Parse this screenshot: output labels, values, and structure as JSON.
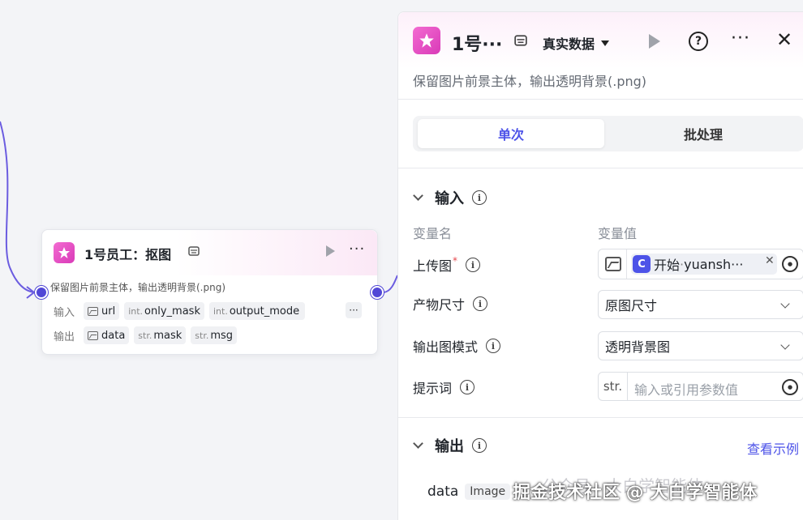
{
  "node": {
    "title": "1号员工：抠图",
    "description": "保留图片前景主体，输出透明背景(.png)",
    "input_label": "输入",
    "output_label": "输出",
    "inputs": [
      {
        "type_prefix": "",
        "icon": "image-icon",
        "name": "url"
      },
      {
        "type_prefix": "int.",
        "icon": "",
        "name": "only_mask"
      },
      {
        "type_prefix": "int.",
        "icon": "",
        "name": "output_mode"
      }
    ],
    "outputs": [
      {
        "type_prefix": "",
        "icon": "image-icon",
        "name": "data"
      },
      {
        "type_prefix": "str.",
        "icon": "",
        "name": "mask"
      },
      {
        "type_prefix": "str.",
        "icon": "",
        "name": "msg"
      }
    ],
    "more_label": "···"
  },
  "panel": {
    "title": "1号···",
    "mode_label": "真实数据",
    "description": "保留图片前景主体，输出透明背景(.png)",
    "tabs": [
      {
        "label": "单次",
        "active": true
      },
      {
        "label": "批处理",
        "active": false
      }
    ],
    "input_section": {
      "title": "输入",
      "col_name": "变量名",
      "col_value": "变量值",
      "fields": [
        {
          "label": "上传图",
          "required_mark": "*",
          "ref_source": "开始",
          "ref_var": "yuansh···",
          "ref_sep": " · "
        },
        {
          "label": "产物尺寸",
          "value": "原图尺寸"
        },
        {
          "label": "输出图模式",
          "value": "透明背景图"
        },
        {
          "label": "提示词",
          "type_tag": "str.",
          "placeholder": "输入或引用参数值"
        }
      ]
    },
    "output_section": {
      "title": "输出",
      "link": "查看示例",
      "rows": [
        {
          "name": "data",
          "type": "Image"
        }
      ]
    }
  },
  "watermark": {
    "main": "掘金技术社区 @ 大白学智能体",
    "faint": "公众号 · 大白学智能体"
  },
  "colors": {
    "accent": "#4d53e8",
    "port": "#5147d6",
    "wire": "#6b5ce0",
    "icon_gradient_start": "#f36bd1",
    "icon_gradient_end": "#d93ab8"
  }
}
